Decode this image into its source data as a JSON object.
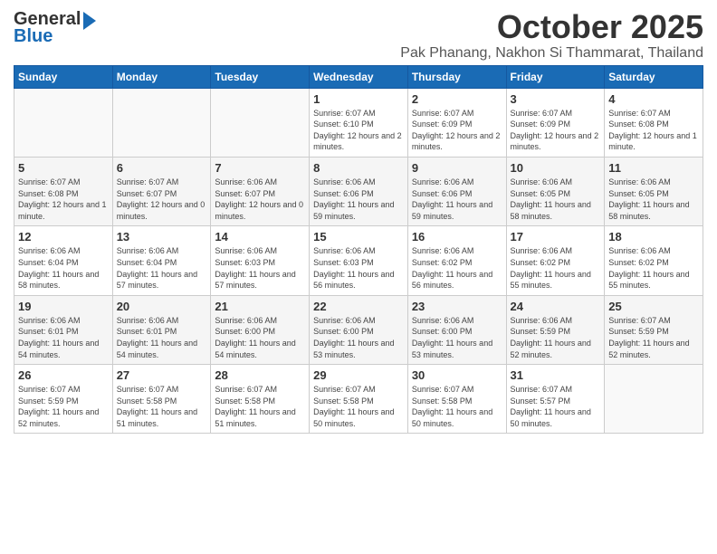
{
  "header": {
    "logo_general": "General",
    "logo_blue": "Blue",
    "month_title": "October 2025",
    "location": "Pak Phanang, Nakhon Si Thammarat, Thailand"
  },
  "days_of_week": [
    "Sunday",
    "Monday",
    "Tuesday",
    "Wednesday",
    "Thursday",
    "Friday",
    "Saturday"
  ],
  "weeks": [
    [
      {
        "day": "",
        "info": ""
      },
      {
        "day": "",
        "info": ""
      },
      {
        "day": "",
        "info": ""
      },
      {
        "day": "1",
        "info": "Sunrise: 6:07 AM\nSunset: 6:10 PM\nDaylight: 12 hours and 2 minutes."
      },
      {
        "day": "2",
        "info": "Sunrise: 6:07 AM\nSunset: 6:09 PM\nDaylight: 12 hours and 2 minutes."
      },
      {
        "day": "3",
        "info": "Sunrise: 6:07 AM\nSunset: 6:09 PM\nDaylight: 12 hours and 2 minutes."
      },
      {
        "day": "4",
        "info": "Sunrise: 6:07 AM\nSunset: 6:08 PM\nDaylight: 12 hours and 1 minute."
      }
    ],
    [
      {
        "day": "5",
        "info": "Sunrise: 6:07 AM\nSunset: 6:08 PM\nDaylight: 12 hours and 1 minute."
      },
      {
        "day": "6",
        "info": "Sunrise: 6:07 AM\nSunset: 6:07 PM\nDaylight: 12 hours and 0 minutes."
      },
      {
        "day": "7",
        "info": "Sunrise: 6:06 AM\nSunset: 6:07 PM\nDaylight: 12 hours and 0 minutes."
      },
      {
        "day": "8",
        "info": "Sunrise: 6:06 AM\nSunset: 6:06 PM\nDaylight: 11 hours and 59 minutes."
      },
      {
        "day": "9",
        "info": "Sunrise: 6:06 AM\nSunset: 6:06 PM\nDaylight: 11 hours and 59 minutes."
      },
      {
        "day": "10",
        "info": "Sunrise: 6:06 AM\nSunset: 6:05 PM\nDaylight: 11 hours and 58 minutes."
      },
      {
        "day": "11",
        "info": "Sunrise: 6:06 AM\nSunset: 6:05 PM\nDaylight: 11 hours and 58 minutes."
      }
    ],
    [
      {
        "day": "12",
        "info": "Sunrise: 6:06 AM\nSunset: 6:04 PM\nDaylight: 11 hours and 58 minutes."
      },
      {
        "day": "13",
        "info": "Sunrise: 6:06 AM\nSunset: 6:04 PM\nDaylight: 11 hours and 57 minutes."
      },
      {
        "day": "14",
        "info": "Sunrise: 6:06 AM\nSunset: 6:03 PM\nDaylight: 11 hours and 57 minutes."
      },
      {
        "day": "15",
        "info": "Sunrise: 6:06 AM\nSunset: 6:03 PM\nDaylight: 11 hours and 56 minutes."
      },
      {
        "day": "16",
        "info": "Sunrise: 6:06 AM\nSunset: 6:02 PM\nDaylight: 11 hours and 56 minutes."
      },
      {
        "day": "17",
        "info": "Sunrise: 6:06 AM\nSunset: 6:02 PM\nDaylight: 11 hours and 55 minutes."
      },
      {
        "day": "18",
        "info": "Sunrise: 6:06 AM\nSunset: 6:02 PM\nDaylight: 11 hours and 55 minutes."
      }
    ],
    [
      {
        "day": "19",
        "info": "Sunrise: 6:06 AM\nSunset: 6:01 PM\nDaylight: 11 hours and 54 minutes."
      },
      {
        "day": "20",
        "info": "Sunrise: 6:06 AM\nSunset: 6:01 PM\nDaylight: 11 hours and 54 minutes."
      },
      {
        "day": "21",
        "info": "Sunrise: 6:06 AM\nSunset: 6:00 PM\nDaylight: 11 hours and 54 minutes."
      },
      {
        "day": "22",
        "info": "Sunrise: 6:06 AM\nSunset: 6:00 PM\nDaylight: 11 hours and 53 minutes."
      },
      {
        "day": "23",
        "info": "Sunrise: 6:06 AM\nSunset: 6:00 PM\nDaylight: 11 hours and 53 minutes."
      },
      {
        "day": "24",
        "info": "Sunrise: 6:06 AM\nSunset: 5:59 PM\nDaylight: 11 hours and 52 minutes."
      },
      {
        "day": "25",
        "info": "Sunrise: 6:07 AM\nSunset: 5:59 PM\nDaylight: 11 hours and 52 minutes."
      }
    ],
    [
      {
        "day": "26",
        "info": "Sunrise: 6:07 AM\nSunset: 5:59 PM\nDaylight: 11 hours and 52 minutes."
      },
      {
        "day": "27",
        "info": "Sunrise: 6:07 AM\nSunset: 5:58 PM\nDaylight: 11 hours and 51 minutes."
      },
      {
        "day": "28",
        "info": "Sunrise: 6:07 AM\nSunset: 5:58 PM\nDaylight: 11 hours and 51 minutes."
      },
      {
        "day": "29",
        "info": "Sunrise: 6:07 AM\nSunset: 5:58 PM\nDaylight: 11 hours and 50 minutes."
      },
      {
        "day": "30",
        "info": "Sunrise: 6:07 AM\nSunset: 5:58 PM\nDaylight: 11 hours and 50 minutes."
      },
      {
        "day": "31",
        "info": "Sunrise: 6:07 AM\nSunset: 5:57 PM\nDaylight: 11 hours and 50 minutes."
      },
      {
        "day": "",
        "info": ""
      }
    ]
  ]
}
